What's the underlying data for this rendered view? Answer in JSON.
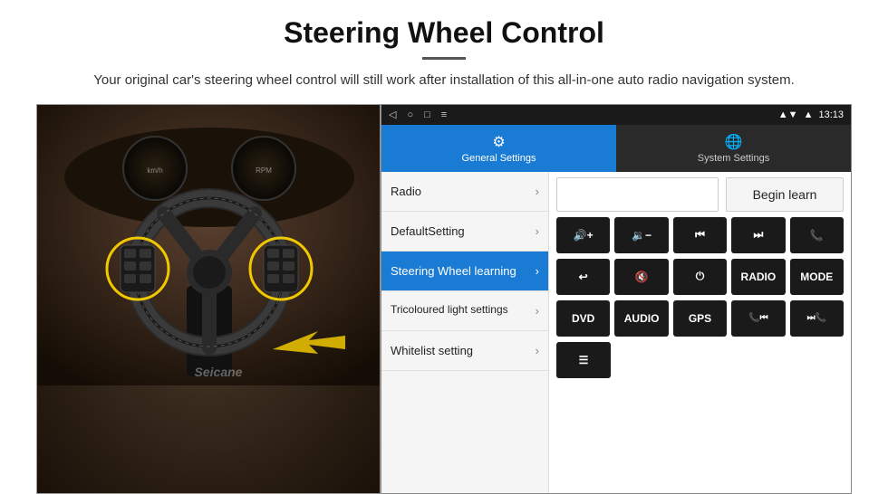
{
  "header": {
    "title": "Steering Wheel Control",
    "subtitle": "Your original car's steering wheel control will still work after installation of this all-in-one auto radio navigation system."
  },
  "status_bar": {
    "time": "13:13",
    "nav_icons": [
      "◁",
      "○",
      "□",
      "≡"
    ]
  },
  "tabs": [
    {
      "id": "general",
      "label": "General Settings",
      "icon": "⚙",
      "active": true
    },
    {
      "id": "system",
      "label": "System Settings",
      "icon": "🌐",
      "active": false
    }
  ],
  "menu_items": [
    {
      "label": "Radio",
      "active": false
    },
    {
      "label": "DefaultSetting",
      "active": false
    },
    {
      "label": "Steering Wheel learning",
      "active": true
    },
    {
      "label": "Tricoloured light settings",
      "active": false
    },
    {
      "label": "Whitelist setting",
      "active": false
    }
  ],
  "begin_learn_label": "Begin learn",
  "buttons_row1": [
    {
      "label": "🔊+",
      "id": "vol-up"
    },
    {
      "label": "🔊-",
      "id": "vol-down"
    },
    {
      "label": "⏮",
      "id": "prev"
    },
    {
      "label": "⏭",
      "id": "next"
    },
    {
      "label": "📞",
      "id": "call"
    }
  ],
  "buttons_row2": [
    {
      "label": "↩",
      "id": "back"
    },
    {
      "label": "🔇",
      "id": "mute"
    },
    {
      "label": "⏻",
      "id": "power"
    },
    {
      "label": "RADIO",
      "id": "radio"
    },
    {
      "label": "MODE",
      "id": "mode"
    }
  ],
  "buttons_row3": [
    {
      "label": "DVD",
      "id": "dvd"
    },
    {
      "label": "AUDIO",
      "id": "audio"
    },
    {
      "label": "GPS",
      "id": "gps"
    },
    {
      "label": "📞⏮",
      "id": "call-prev"
    },
    {
      "label": "⏭📞",
      "id": "call-next"
    }
  ],
  "buttons_row4": [
    {
      "label": "≡",
      "id": "menu-icon"
    }
  ],
  "seicane_label": "Seicane"
}
